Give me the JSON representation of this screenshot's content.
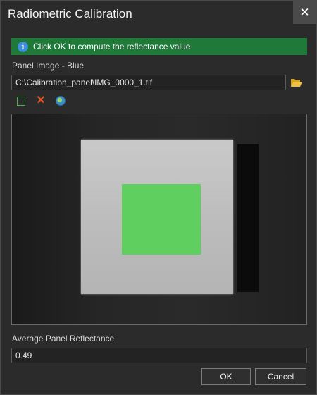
{
  "window": {
    "title": "Radiometric Calibration",
    "close_label": "✕"
  },
  "banner": {
    "icon": "info-icon",
    "text": "Click OK to compute the reflectance value",
    "color": "#1f7a3a"
  },
  "panel_image": {
    "label": "Panel Image - Blue",
    "path": "C:\\Calibration_panel\\IMG_0000_1.tif"
  },
  "toolbar": {
    "icons": [
      "square-select-icon",
      "delete-icon",
      "globe-icon"
    ]
  },
  "reflectance": {
    "label": "Average Panel Reflectance",
    "value": "0.49"
  },
  "buttons": {
    "ok": "OK",
    "cancel": "Cancel"
  },
  "colors": {
    "roi": "#5fcf5f",
    "accent_green": "#1f7a3a",
    "delete": "#e0552a"
  }
}
